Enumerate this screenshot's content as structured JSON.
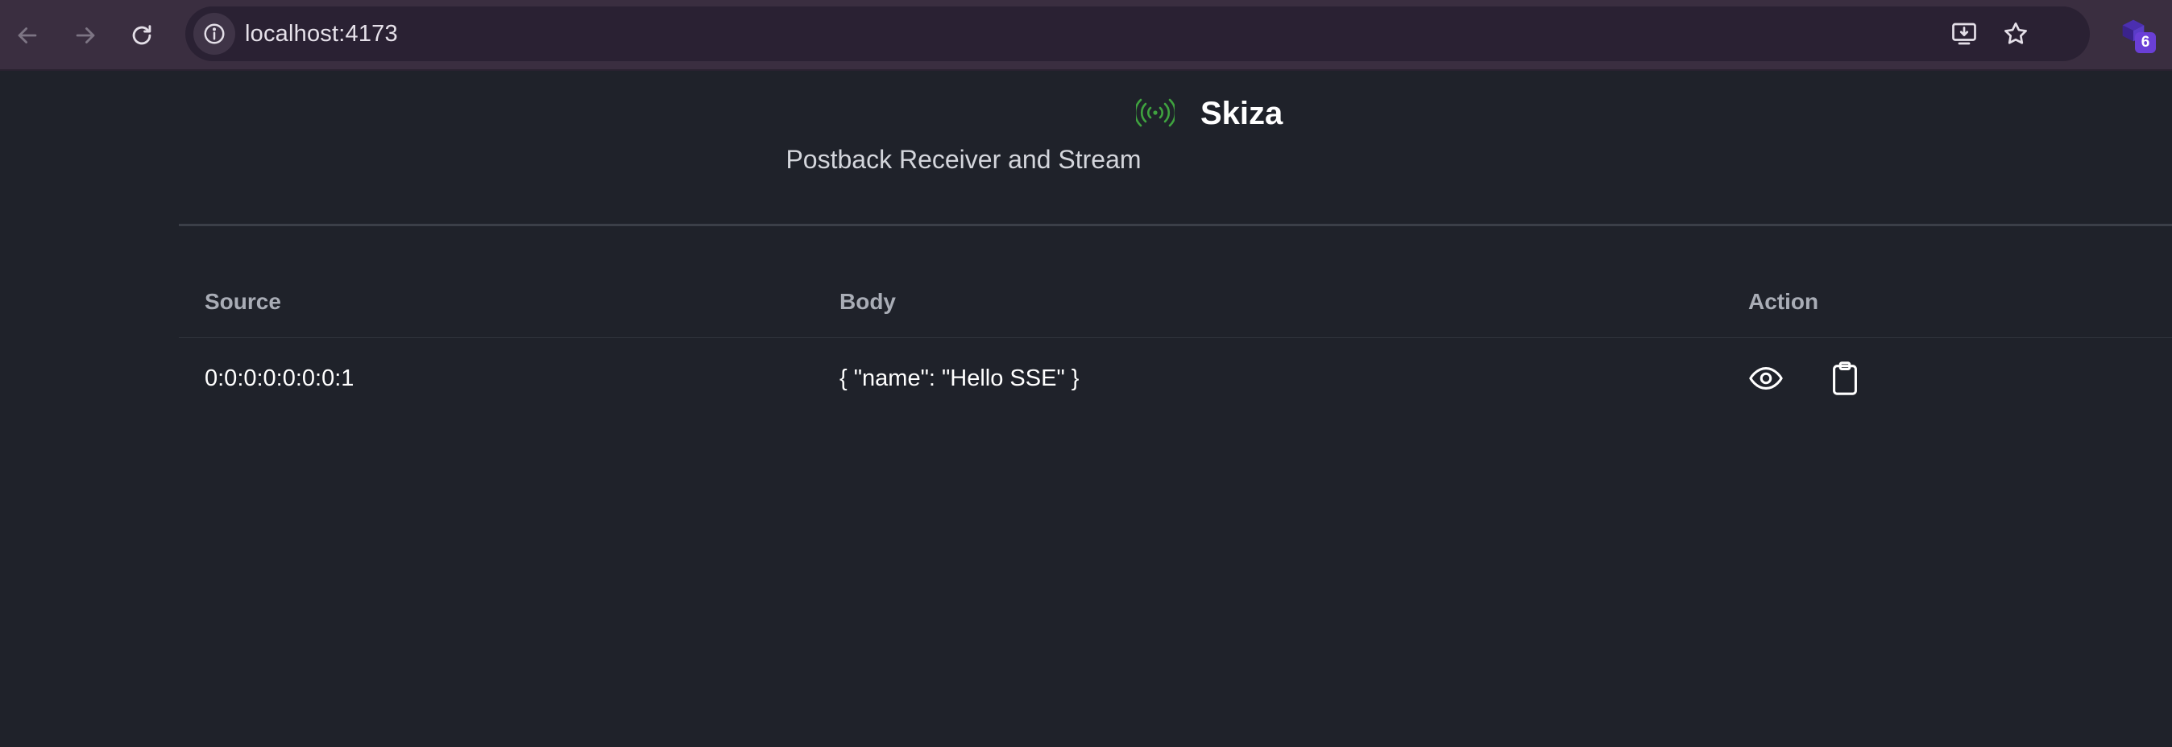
{
  "browser": {
    "url": "localhost:4173",
    "extension_badge": "6",
    "colors": {
      "frame": "#3a2e40",
      "omnibox": "#2a2133",
      "badge": "#6a3fd6"
    }
  },
  "icons": {
    "back": "arrow-left-icon",
    "forward": "arrow-right-icon",
    "reload": "reload-icon",
    "info": "info-icon",
    "install": "install-app-icon",
    "bookmark": "star-icon",
    "extension": "extension-icon",
    "app": "broadcast-signal-icon",
    "view": "eye-icon",
    "copy": "clipboard-icon"
  },
  "app": {
    "title": "Skiza",
    "subtitle": "Postback Receiver and Stream",
    "accent": "#3fa33f",
    "background": "#1f222a"
  },
  "table": {
    "columns": [
      "Source",
      "Body",
      "Action"
    ],
    "rows": [
      {
        "source": "0:0:0:0:0:0:0:1",
        "body": "{ \"name\": \"Hello SSE\" }"
      }
    ]
  }
}
